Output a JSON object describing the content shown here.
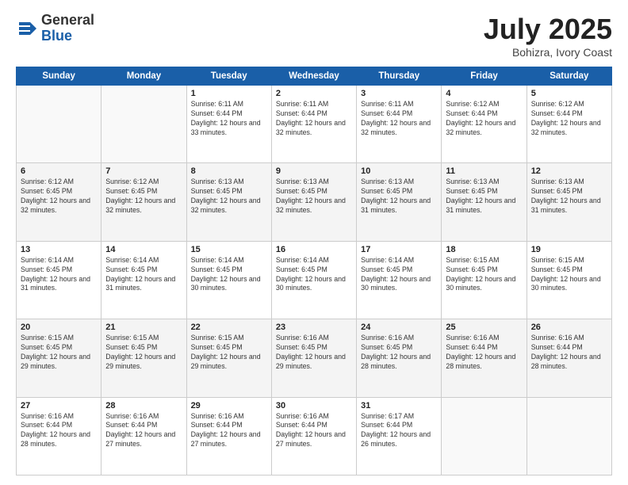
{
  "header": {
    "logo_general": "General",
    "logo_blue": "Blue",
    "month_title": "July 2025",
    "location": "Bohizra, Ivory Coast"
  },
  "days_of_week": [
    "Sunday",
    "Monday",
    "Tuesday",
    "Wednesday",
    "Thursday",
    "Friday",
    "Saturday"
  ],
  "weeks": [
    [
      {
        "day": "",
        "info": ""
      },
      {
        "day": "",
        "info": ""
      },
      {
        "day": "1",
        "info": "Sunrise: 6:11 AM\nSunset: 6:44 PM\nDaylight: 12 hours and 33 minutes."
      },
      {
        "day": "2",
        "info": "Sunrise: 6:11 AM\nSunset: 6:44 PM\nDaylight: 12 hours and 32 minutes."
      },
      {
        "day": "3",
        "info": "Sunrise: 6:11 AM\nSunset: 6:44 PM\nDaylight: 12 hours and 32 minutes."
      },
      {
        "day": "4",
        "info": "Sunrise: 6:12 AM\nSunset: 6:44 PM\nDaylight: 12 hours and 32 minutes."
      },
      {
        "day": "5",
        "info": "Sunrise: 6:12 AM\nSunset: 6:44 PM\nDaylight: 12 hours and 32 minutes."
      }
    ],
    [
      {
        "day": "6",
        "info": "Sunrise: 6:12 AM\nSunset: 6:45 PM\nDaylight: 12 hours and 32 minutes."
      },
      {
        "day": "7",
        "info": "Sunrise: 6:12 AM\nSunset: 6:45 PM\nDaylight: 12 hours and 32 minutes."
      },
      {
        "day": "8",
        "info": "Sunrise: 6:13 AM\nSunset: 6:45 PM\nDaylight: 12 hours and 32 minutes."
      },
      {
        "day": "9",
        "info": "Sunrise: 6:13 AM\nSunset: 6:45 PM\nDaylight: 12 hours and 32 minutes."
      },
      {
        "day": "10",
        "info": "Sunrise: 6:13 AM\nSunset: 6:45 PM\nDaylight: 12 hours and 31 minutes."
      },
      {
        "day": "11",
        "info": "Sunrise: 6:13 AM\nSunset: 6:45 PM\nDaylight: 12 hours and 31 minutes."
      },
      {
        "day": "12",
        "info": "Sunrise: 6:13 AM\nSunset: 6:45 PM\nDaylight: 12 hours and 31 minutes."
      }
    ],
    [
      {
        "day": "13",
        "info": "Sunrise: 6:14 AM\nSunset: 6:45 PM\nDaylight: 12 hours and 31 minutes."
      },
      {
        "day": "14",
        "info": "Sunrise: 6:14 AM\nSunset: 6:45 PM\nDaylight: 12 hours and 31 minutes."
      },
      {
        "day": "15",
        "info": "Sunrise: 6:14 AM\nSunset: 6:45 PM\nDaylight: 12 hours and 30 minutes."
      },
      {
        "day": "16",
        "info": "Sunrise: 6:14 AM\nSunset: 6:45 PM\nDaylight: 12 hours and 30 minutes."
      },
      {
        "day": "17",
        "info": "Sunrise: 6:14 AM\nSunset: 6:45 PM\nDaylight: 12 hours and 30 minutes."
      },
      {
        "day": "18",
        "info": "Sunrise: 6:15 AM\nSunset: 6:45 PM\nDaylight: 12 hours and 30 minutes."
      },
      {
        "day": "19",
        "info": "Sunrise: 6:15 AM\nSunset: 6:45 PM\nDaylight: 12 hours and 30 minutes."
      }
    ],
    [
      {
        "day": "20",
        "info": "Sunrise: 6:15 AM\nSunset: 6:45 PM\nDaylight: 12 hours and 29 minutes."
      },
      {
        "day": "21",
        "info": "Sunrise: 6:15 AM\nSunset: 6:45 PM\nDaylight: 12 hours and 29 minutes."
      },
      {
        "day": "22",
        "info": "Sunrise: 6:15 AM\nSunset: 6:45 PM\nDaylight: 12 hours and 29 minutes."
      },
      {
        "day": "23",
        "info": "Sunrise: 6:16 AM\nSunset: 6:45 PM\nDaylight: 12 hours and 29 minutes."
      },
      {
        "day": "24",
        "info": "Sunrise: 6:16 AM\nSunset: 6:45 PM\nDaylight: 12 hours and 28 minutes."
      },
      {
        "day": "25",
        "info": "Sunrise: 6:16 AM\nSunset: 6:44 PM\nDaylight: 12 hours and 28 minutes."
      },
      {
        "day": "26",
        "info": "Sunrise: 6:16 AM\nSunset: 6:44 PM\nDaylight: 12 hours and 28 minutes."
      }
    ],
    [
      {
        "day": "27",
        "info": "Sunrise: 6:16 AM\nSunset: 6:44 PM\nDaylight: 12 hours and 28 minutes."
      },
      {
        "day": "28",
        "info": "Sunrise: 6:16 AM\nSunset: 6:44 PM\nDaylight: 12 hours and 27 minutes."
      },
      {
        "day": "29",
        "info": "Sunrise: 6:16 AM\nSunset: 6:44 PM\nDaylight: 12 hours and 27 minutes."
      },
      {
        "day": "30",
        "info": "Sunrise: 6:16 AM\nSunset: 6:44 PM\nDaylight: 12 hours and 27 minutes."
      },
      {
        "day": "31",
        "info": "Sunrise: 6:17 AM\nSunset: 6:44 PM\nDaylight: 12 hours and 26 minutes."
      },
      {
        "day": "",
        "info": ""
      },
      {
        "day": "",
        "info": ""
      }
    ]
  ]
}
